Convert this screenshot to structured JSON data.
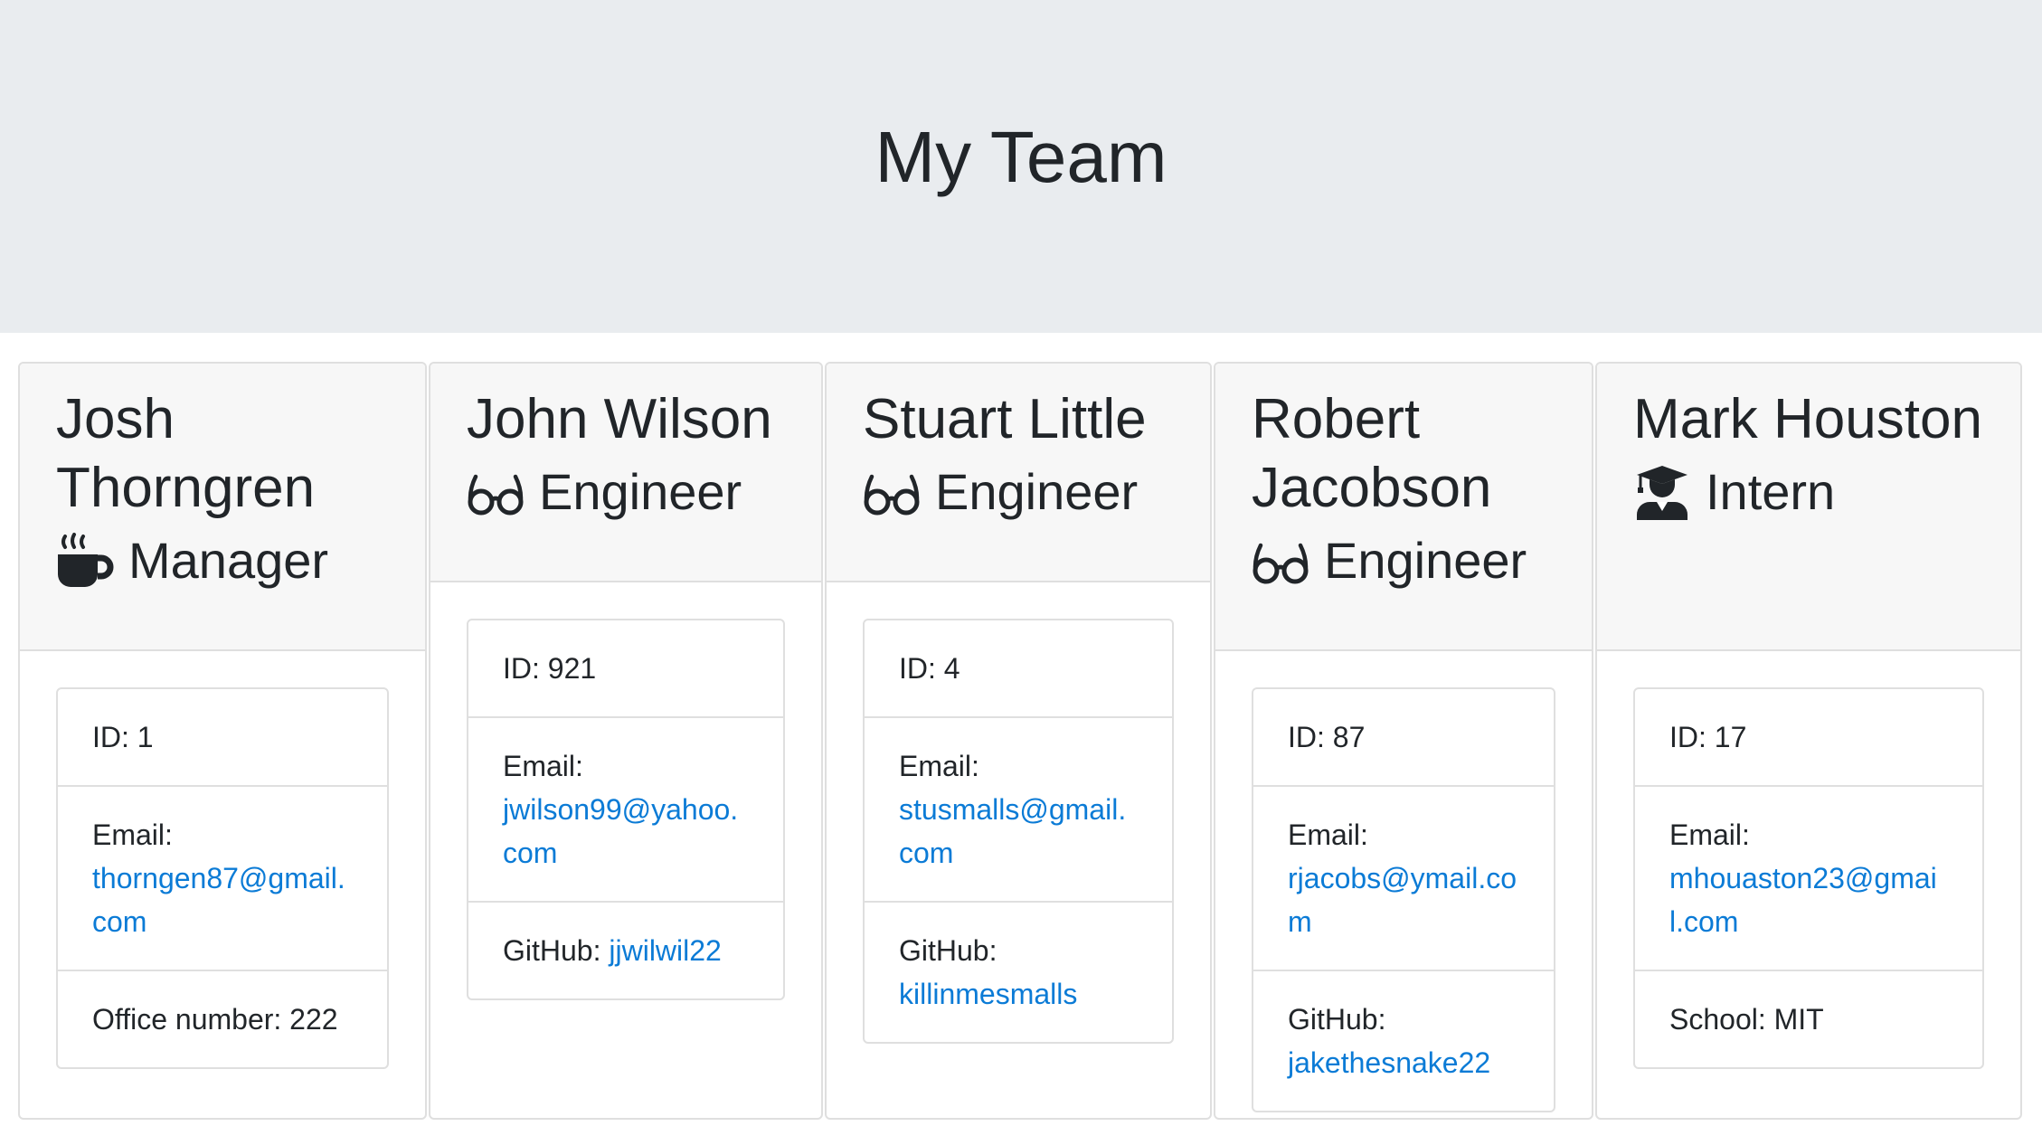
{
  "header": {
    "title": "My Team"
  },
  "labels": {
    "id": "ID: ",
    "email": "Email:",
    "github": "GitHub: ",
    "office": "Office number: ",
    "school": "School: "
  },
  "team": [
    {
      "name": "Josh Thorngren",
      "role": "Manager",
      "icon": "coffee-icon",
      "id": "1",
      "email": "thorngen87@gmail.com",
      "extra_label": "Office number: ",
      "extra_value": "222"
    },
    {
      "name": "John Wilson",
      "role": "Engineer",
      "icon": "glasses-icon",
      "id": "921",
      "email": "jwilson99@yahoo.com",
      "extra_label": "GitHub: ",
      "extra_value": "jjwilwil22"
    },
    {
      "name": "Stuart Little",
      "role": "Engineer",
      "icon": "glasses-icon",
      "id": "4",
      "email": "stusmalls@gmail.com",
      "extra_label": "GitHub: ",
      "extra_value": "killinmesmalls"
    },
    {
      "name": "Robert Jacobson",
      "role": "Engineer",
      "icon": "glasses-icon",
      "id": "87",
      "email": "rjacobs@ymail.com",
      "extra_label": "GitHub: ",
      "extra_value": "jakethesnake22"
    },
    {
      "name": "Mark Houston",
      "role": "Intern",
      "icon": "graduate-icon",
      "id": "17",
      "email": "mhouaston23@gmail.com",
      "extra_label": "School: ",
      "extra_value": "MIT"
    }
  ],
  "colors": {
    "header_bg": "#e9ecef",
    "card_header_bg": "#f7f7f7",
    "link": "#0b7bd6",
    "text": "#212529"
  }
}
